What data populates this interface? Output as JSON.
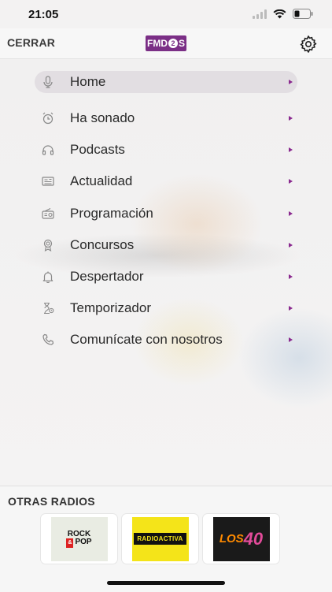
{
  "status_bar": {
    "time": "21:05"
  },
  "header": {
    "close_label": "CERRAR",
    "logo_text_a": "FM",
    "logo_text_b": "D",
    "logo_text_c": "2",
    "logo_text_d": "S"
  },
  "menu": {
    "items": [
      {
        "label": "Home",
        "icon": "microphone-icon",
        "active": true
      },
      {
        "label": "Ha sonado",
        "icon": "alarm-clock-icon"
      },
      {
        "label": "Podcasts",
        "icon": "headphones-icon"
      },
      {
        "label": "Actualidad",
        "icon": "newspaper-icon"
      },
      {
        "label": "Programación",
        "icon": "radio-icon"
      },
      {
        "label": "Concursos",
        "icon": "award-icon"
      },
      {
        "label": "Despertador",
        "icon": "bell-icon"
      },
      {
        "label": "Temporizador",
        "icon": "hourglass-icon"
      },
      {
        "label": "Comunícate con nosotros",
        "icon": "phone-icon"
      }
    ],
    "arrow_color": "#8a2a8f"
  },
  "other_radios": {
    "title": "OTRAS RADIOS",
    "stations": [
      {
        "name": "Rock & Pop",
        "logo_line1": "ROCK",
        "logo_amp": "&",
        "logo_line2": "POP"
      },
      {
        "name": "Radioactiva",
        "logo_text": "RADIOACTIVA"
      },
      {
        "name": "Los 40",
        "logo_text": "LOS",
        "logo_num": "40"
      }
    ]
  },
  "colors": {
    "brand": "#7b2f86",
    "accent_arrow": "#8a2a8f"
  }
}
